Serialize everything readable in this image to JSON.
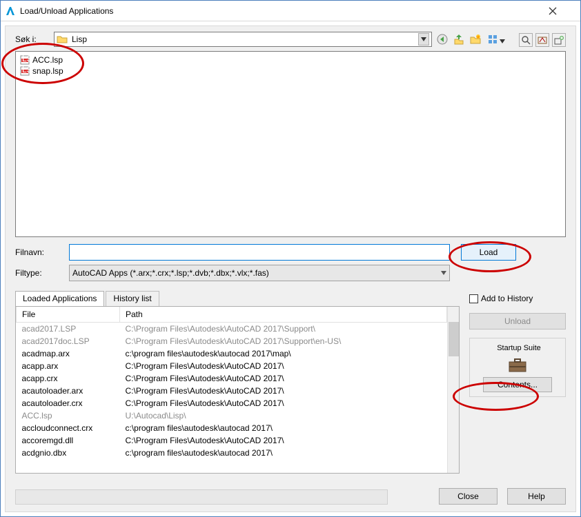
{
  "window": {
    "title": "Load/Unload Applications"
  },
  "labels": {
    "look_in": "Søk i:",
    "filename": "Filnavn:",
    "filetype": "Filtype:",
    "add_history": "Add to History",
    "startup_suite": "Startup Suite"
  },
  "look_in": {
    "value": "Lisp"
  },
  "filename": {
    "value": "",
    "placeholder": ""
  },
  "filetype": {
    "value": "AutoCAD Apps (*.arx;*.crx;*.lsp;*.dvb;*.dbx;*.vlx;*.fas)"
  },
  "buttons": {
    "load": "Load",
    "unload": "Unload",
    "contents": "Contents...",
    "close": "Close",
    "help": "Help"
  },
  "files_in_folder": [
    {
      "name": "ACC.lsp"
    },
    {
      "name": "snap.lsp"
    }
  ],
  "tabs": {
    "loaded": "Loaded Applications",
    "history": "History list"
  },
  "columns": {
    "file": "File",
    "path": "Path"
  },
  "loaded_apps": [
    {
      "file": "acad2017.LSP",
      "path": "C:\\Program Files\\Autodesk\\AutoCAD 2017\\Support\\",
      "gray": true
    },
    {
      "file": "acad2017doc.LSP",
      "path": "C:\\Program Files\\Autodesk\\AutoCAD 2017\\Support\\en-US\\",
      "gray": true
    },
    {
      "file": "acadmap.arx",
      "path": "c:\\program files\\autodesk\\autocad 2017\\map\\",
      "gray": false
    },
    {
      "file": "acapp.arx",
      "path": "C:\\Program Files\\Autodesk\\AutoCAD 2017\\",
      "gray": false
    },
    {
      "file": "acapp.crx",
      "path": "C:\\Program Files\\Autodesk\\AutoCAD 2017\\",
      "gray": false
    },
    {
      "file": "acautoloader.arx",
      "path": "C:\\Program Files\\Autodesk\\AutoCAD 2017\\",
      "gray": false
    },
    {
      "file": "acautoloader.crx",
      "path": "C:\\Program Files\\Autodesk\\AutoCAD 2017\\",
      "gray": false
    },
    {
      "file": "ACC.lsp",
      "path": "U:\\Autocad\\Lisp\\",
      "gray": true
    },
    {
      "file": "accloudconnect.crx",
      "path": "c:\\program files\\autodesk\\autocad 2017\\",
      "gray": false
    },
    {
      "file": "accoremgd.dll",
      "path": "C:\\Program Files\\Autodesk\\AutoCAD 2017\\",
      "gray": false
    },
    {
      "file": "acdgnio.dbx",
      "path": "c:\\program files\\autodesk\\autocad 2017\\",
      "gray": false
    }
  ],
  "icons": {
    "app": "autodesk-app-icon",
    "close_x": "close-icon",
    "back": "back-icon",
    "up": "up-icon",
    "new": "new-folder-icon",
    "views": "views-icon",
    "search": "search-icon",
    "autocad": "autocad-icon",
    "add_tool": "add-to-box-icon",
    "folder": "folder-icon",
    "lsp": "lsp-file-icon",
    "briefcase": "briefcase-icon"
  }
}
